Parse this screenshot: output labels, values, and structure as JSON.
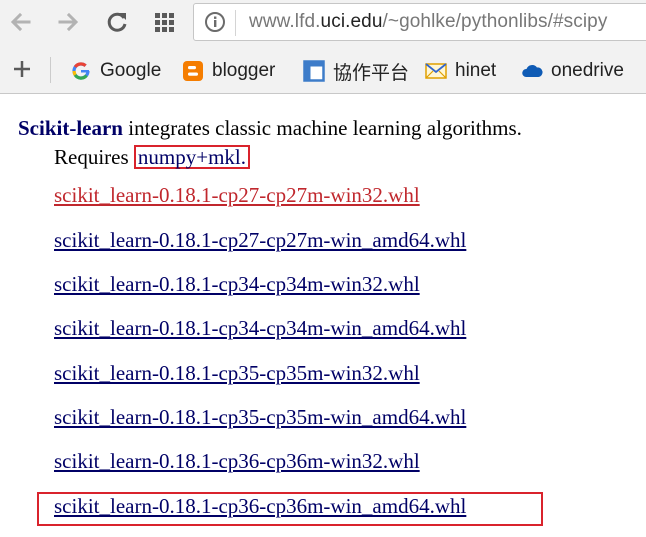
{
  "browser": {
    "url_prefix": "www.lfd.",
    "url_host": "uci.edu",
    "url_suffix": "/~gohlke/pythonlibs/#scipy"
  },
  "bookmarks": [
    {
      "label": "Google",
      "icon": "google-icon"
    },
    {
      "label": "blogger",
      "icon": "blogger-icon"
    },
    {
      "label": "協作平台",
      "icon": "sites-icon"
    },
    {
      "label": "hinet",
      "icon": "mail-icon"
    },
    {
      "label": "onedrive",
      "icon": "cloud-icon"
    }
  ],
  "content": {
    "package_name": "Scikit-learn",
    "description": " integrates classic machine learning algorithms.",
    "requires_label": "Requires ",
    "requires_dep": "numpy+mkl."
  },
  "files": [
    "scikit_learn-0.18.1-cp27-cp27m-win32.whl",
    "scikit_learn-0.18.1-cp27-cp27m-win_amd64.whl",
    "scikit_learn-0.18.1-cp34-cp34m-win32.whl",
    "scikit_learn-0.18.1-cp34-cp34m-win_amd64.whl",
    "scikit_learn-0.18.1-cp35-cp35m-win32.whl",
    "scikit_learn-0.18.1-cp35-cp35m-win_amd64.whl",
    "scikit_learn-0.18.1-cp36-cp36m-win32.whl",
    "scikit_learn-0.18.1-cp36-cp36m-win_amd64.whl"
  ],
  "colors": {
    "link": "#000066",
    "visited_link": "#c0272d",
    "highlight": "#d9232c"
  }
}
